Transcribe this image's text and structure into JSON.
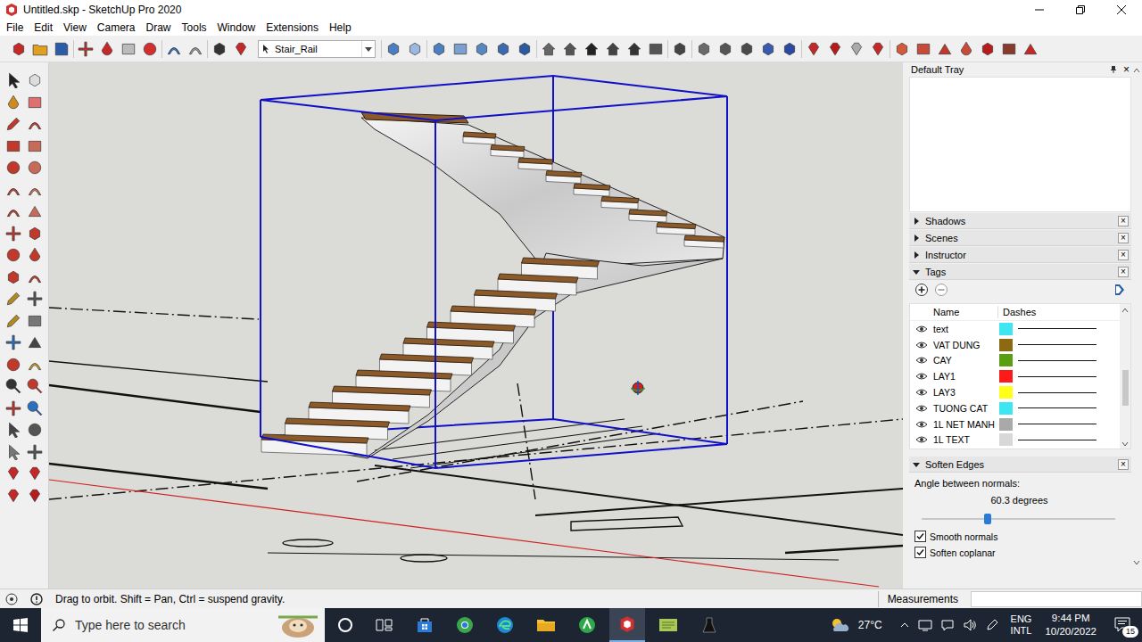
{
  "window": {
    "title": "Untitled.skp - SketchUp Pro 2020"
  },
  "menu": [
    "File",
    "Edit",
    "View",
    "Camera",
    "Draw",
    "Tools",
    "Window",
    "Extensions",
    "Help"
  ],
  "toolbar": {
    "tag_dropdown": "Stair_Rail"
  },
  "tray": {
    "title": "Default Tray",
    "close_glyph": "×",
    "panels": [
      {
        "title": "Shadows",
        "expanded": false
      },
      {
        "title": "Scenes",
        "expanded": false
      },
      {
        "title": "Instructor",
        "expanded": false
      },
      {
        "title": "Tags",
        "expanded": true
      }
    ],
    "tags": {
      "columns": [
        "Name",
        "Dashes"
      ],
      "rows": [
        {
          "name": "text",
          "visible": true,
          "color": "#3ee6f2"
        },
        {
          "name": "VAT DUNG",
          "visible": true,
          "color": "#8c6a12"
        },
        {
          "name": "CAY",
          "visible": true,
          "color": "#5b9e12"
        },
        {
          "name": "LAY1",
          "visible": true,
          "color": "#ff1a1a"
        },
        {
          "name": "LAY3",
          "visible": true,
          "color": "#ffff1a"
        },
        {
          "name": "TUONG CAT",
          "visible": true,
          "color": "#3ee6f2"
        },
        {
          "name": "1L NET MANH",
          "visible": true,
          "color": "#a9a9a9"
        },
        {
          "name": "1L TEXT",
          "visible": true,
          "color": "#d8d8d8"
        }
      ]
    },
    "soften_edges": {
      "title": "Soften Edges",
      "expanded": true,
      "angle_label": "Angle between normals:",
      "reading": "60.3 degrees",
      "level": 0.34,
      "options": [
        {
          "label": "Smooth normals",
          "checked": true
        },
        {
          "label": "Soften coplanar",
          "checked": true
        }
      ]
    }
  },
  "status_bar": {
    "hint": "Drag to orbit. Shift = Pan, Ctrl = suspend gravity.",
    "measurements_label": "Measurements"
  },
  "taskbar": {
    "search_placeholder": "Type here to search",
    "weather": "27°C",
    "language": [
      "ENG",
      "INTL"
    ],
    "time": "9:44 PM",
    "date": "10/20/2022",
    "notifications": "15"
  }
}
